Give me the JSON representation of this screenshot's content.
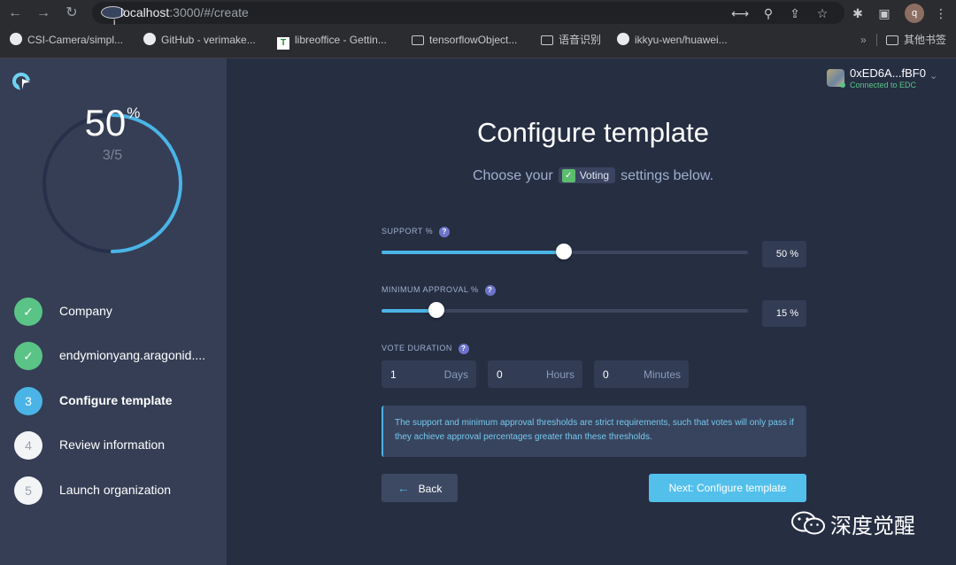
{
  "browser": {
    "url_host": "localhost",
    "url_rest": ":3000/#/create",
    "avatar_letter": "q",
    "bookmarks": [
      {
        "label": "CSI-Camera/simpl...",
        "icon": "github-icon"
      },
      {
        "label": "GitHub - verimake...",
        "icon": "github-icon"
      },
      {
        "label": "libreoffice - Gettin...",
        "icon": "libreoffice-icon"
      },
      {
        "label": "tensorflowObject...",
        "icon": "folder-icon"
      },
      {
        "label": "语音识别",
        "icon": "folder-icon"
      },
      {
        "label": "ikkyu-wen/huawei...",
        "icon": "github-icon"
      }
    ],
    "overflow": "»",
    "other_bookmarks": "其他书签"
  },
  "sidebar": {
    "progress_percent": 50,
    "progress_value": "50",
    "progress_symbol": "%",
    "progress_fraction": "3/5",
    "steps": [
      {
        "marker": "✓",
        "label": "Company",
        "state": "done"
      },
      {
        "marker": "✓",
        "label": "endymionyang.aragonid....",
        "state": "done"
      },
      {
        "marker": "3",
        "label": "Configure template",
        "state": "active"
      },
      {
        "marker": "4",
        "label": "Review information",
        "state": "todo"
      },
      {
        "marker": "5",
        "label": "Launch organization",
        "state": "todo"
      }
    ]
  },
  "account": {
    "address": "0xED6A...fBF0",
    "status": "Connected to EDC"
  },
  "main": {
    "title": "Configure template",
    "subtitle_pre": "Choose your",
    "template_name": "Voting",
    "subtitle_post": "settings below.",
    "support": {
      "label": "SUPPORT %",
      "value": 50,
      "display": "50 %"
    },
    "min_approval": {
      "label": "MINIMUM APPROVAL %",
      "value": 15,
      "display": "15 %"
    },
    "duration": {
      "label": "VOTE DURATION",
      "days": "1",
      "days_unit": "Days",
      "hours": "0",
      "hours_unit": "Hours",
      "minutes": "0",
      "minutes_unit": "Minutes"
    },
    "info_text": "The support and minimum approval thresholds are strict requirements, such that votes will only pass if they achieve approval percentages greater than these thresholds.",
    "back_label": "Back",
    "next_label": "Next: Configure template"
  },
  "watermark": "深度觉醒",
  "colors": {
    "accent": "#4bb4e6",
    "success": "#5ac386",
    "sidebar_bg": "#353e54",
    "main_bg": "#262e42"
  }
}
